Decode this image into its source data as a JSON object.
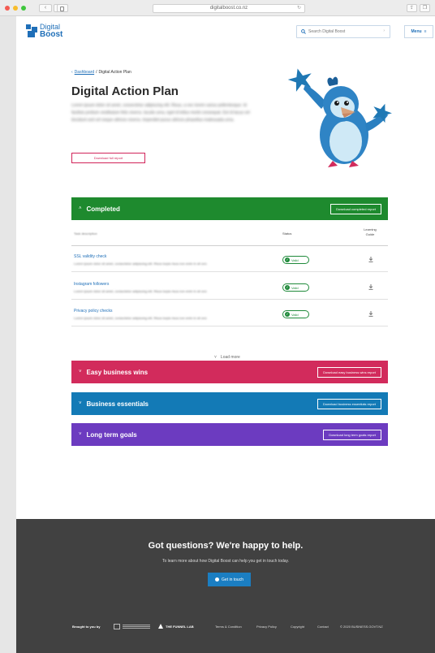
{
  "browser": {
    "url": "digitalboost.co.nz",
    "dot_colors": [
      "#f45b52",
      "#f8bd2c",
      "#3ec63c"
    ]
  },
  "header": {
    "logo_line1": "Digital",
    "logo_line2": "Boost",
    "search_placeholder": "Search Digital Boost",
    "menu_label": "Menu"
  },
  "hero": {
    "breadcrumb_link": "Dashboard",
    "breadcrumb_separator": "/",
    "breadcrumb_current": "Digital Action Plan",
    "title": "Digital Action Plan",
    "intro": "Lorem ipsum dolor sit amet, consectetur adipiscing elit. Risus, a nec lorem varius pellentesque. Id facilisis pretium vestibulum felis viverra. Iaculis urna, eget id tellus morbi consequat. Est id lacus vel tincidunt sed vel neque ultrices viverra. Imperdiet purus ultrices phasellus malesuada urna.",
    "download_full": "Download full report"
  },
  "sections": {
    "completed": {
      "name": "Completed",
      "download": "Download completed report",
      "color": "#1e8a2e"
    },
    "easy": {
      "name": "Easy business wins",
      "download": "Download easy business wins report",
      "color": "#d22b5c"
    },
    "essentials": {
      "name": "Business essentials",
      "download": "Download business essentials report",
      "color": "#137ab6"
    },
    "longterm": {
      "name": "Long term goals",
      "download": "Download long term goals report",
      "color": "#6c3bc0"
    }
  },
  "table": {
    "col_description": "Task description",
    "col_status": "Status",
    "col_guide_line1": "Learning",
    "col_guide_line2": "Guide",
    "rows": [
      {
        "title": "SSL validity check",
        "desc": "Lorem ipsum dolor sit amet, consectetur adipiscing elit. Risus turpis risus non enim in sit orci.",
        "status": "Valid"
      },
      {
        "title": "Instagram followers",
        "desc": "Lorem ipsum dolor sit amet, consectetur adipiscing elit. Risus turpis risus non enim in sit orci.",
        "status": "Valid"
      },
      {
        "title": "Privacy policy checks",
        "desc": "Lorem ipsum dolor sit amet, consectetur adipiscing elit. Risus turpis risus non enim in sit orci.",
        "status": "Valid"
      }
    ],
    "load_more": "Load more"
  },
  "footer": {
    "title": "Got questions? We're happy to help.",
    "subtitle": "To learn more about how Digital Boost can help you get in touch today.",
    "cta": "Get in touch",
    "brought": "Brought to you by",
    "funnel": "THE FUNNEL LAB",
    "terms": "Terms & Condition",
    "privacy": "Privacy Policy",
    "copyright": "Copyright",
    "contact": "Contact",
    "copy": "© 2020 BUSINESS.GOVT.NZ"
  }
}
